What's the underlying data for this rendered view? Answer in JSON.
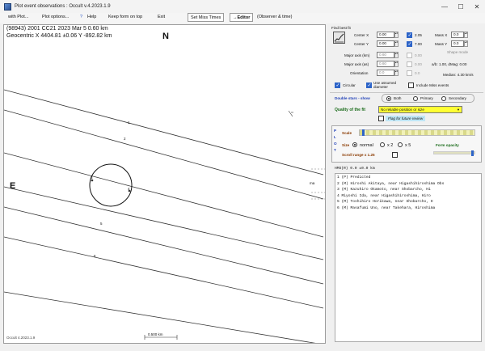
{
  "window": {
    "title": "Plot event observations : Occult v.4.2023.1.9",
    "controls": [
      "—",
      "☐",
      "✕"
    ]
  },
  "menu": {
    "with_plot": "with Plot...",
    "plot_options": "Plot options...",
    "help": "Help",
    "keep_on_top": "Keep form on top",
    "exit": "Exit",
    "set_miss_times": "Set Miss Times",
    "editor": "→Editor",
    "observer_time": "(Observer & time)"
  },
  "plot": {
    "header_line1": "(98943) 2001 CC21  2023 Mar 5  0.60 km",
    "header_line2": "Geocentric X 4404.81 ±0.06  Y -892.82 km",
    "north": "N",
    "east": "E",
    "version": "Occult 4.2023.1.9",
    "scale_bar": "0.500 km",
    "chord_labels": [
      "1",
      "2",
      "3",
      "4",
      "5",
      "6"
    ],
    "miss_label": "ma"
  },
  "fit": {
    "section_label": "Find best fit",
    "center_x_label": "Center X",
    "center_x": "0.00",
    "center_y_label": "Center Y",
    "center_y": "0.00",
    "cx_step": "2.05",
    "cy_step": "7.00",
    "major_axis_km_label": "Major axis (km)",
    "major_axis_km": "0.60",
    "major_axis_km_step": "0.00",
    "major_axis_label": "Major axis (as)",
    "major_axis": "0.60",
    "major_axis_step": "0.00",
    "orientation_label": "Orientation",
    "orientation": "0.0",
    "orientation_step": "0.0",
    "mass_x_label": "Mass X",
    "mass_x": "0.0",
    "mass_y_label": "Mass Y",
    "mass_y": "0.0",
    "shape_mode": "Shape mode",
    "ab_ratio": "a/b: 1.00, dMag: 0.00",
    "median": "Median: 4.30 km/s",
    "circular_label": "Circular",
    "use_assumed_label": "Use assumed diameter",
    "include_miss_label": "Include Miss events"
  },
  "double": {
    "label": "Double stars - show",
    "options": [
      "Both",
      "Primary",
      "Secondary"
    ]
  },
  "quality": {
    "label": "Quality of the fit",
    "value": "No reliable position or size",
    "flag_label": "Flag for future review"
  },
  "plot_panel": {
    "side_label": [
      "P",
      "L",
      "O",
      "T"
    ],
    "scale_label": "Scale",
    "size_label": "Size",
    "size_options": [
      "normal",
      "x 2",
      "x 5"
    ],
    "form_opacity": "Form opacity",
    "scroll_range": "Scroll range x 1.25"
  },
  "observers": {
    "header": "HMS(R) 0.0 ±0.0 km",
    "rows": [
      "1 (P)  Predicted",
      "2 (M)  Hiroshi Akitaya, near Higashihiroshima Obs",
      "3 (M)  Kazuhiro Okamoto, near Shobarcho, Hi",
      "4      Miyoshi Ida, near Higashihiroshima, Hiro",
      "5 (M)  Toshihiro Horikawa, near Shobarcho, H",
      "6 (M)  Masafumi Uno, near Takehara, Hiroshima"
    ]
  }
}
